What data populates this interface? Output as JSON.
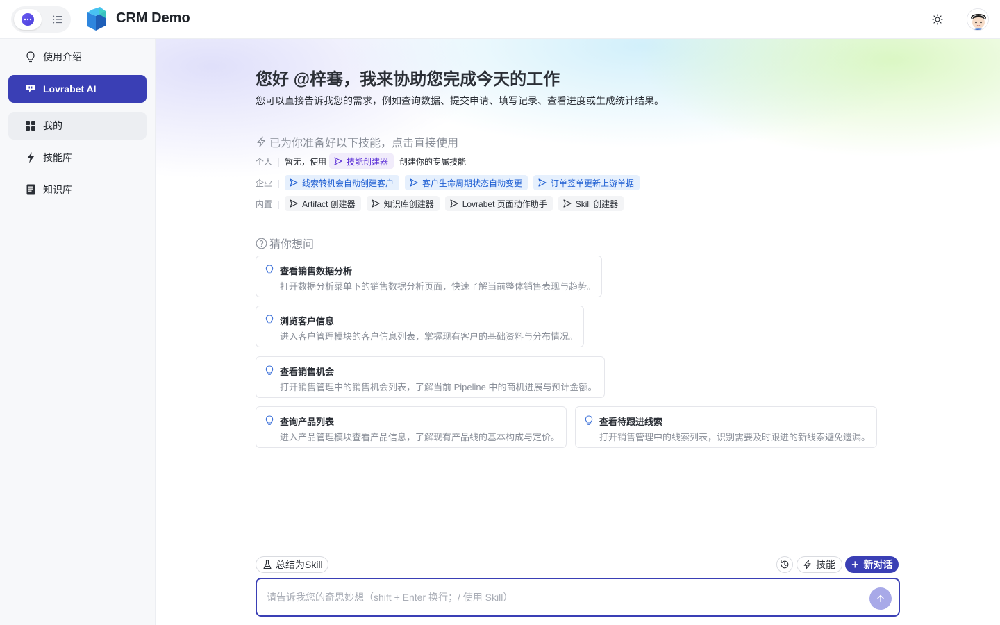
{
  "app": {
    "title": "CRM Demo"
  },
  "sidebar": {
    "items": [
      {
        "label": "使用介绍",
        "icon": "lightbulb-icon"
      },
      {
        "label": "Lovrabet AI",
        "icon": "chat-bubble-icon",
        "active": true
      },
      {
        "label": "我的",
        "icon": "grid-icon"
      },
      {
        "label": "技能库",
        "icon": "lightning-icon"
      },
      {
        "label": "知识库",
        "icon": "book-icon"
      }
    ]
  },
  "main": {
    "greeting": "您好 @梓骞，我来协助您完成今天的工作",
    "subtitle": "您可以直接告诉我您的需求，例如查询数据、提交申请、填写记录、查看进度或生成统计结果。",
    "skills": {
      "heading": "已为你准备好以下技能，点击直接使用",
      "personal": {
        "label": "个人",
        "prefix": "暂无，使用",
        "chip": "技能创建器",
        "suffix": "创建你的专属技能"
      },
      "enterprise": {
        "label": "企业",
        "chips": [
          "线索转机会自动创建客户",
          "客户生命周期状态自动变更",
          "订单签单更新上游单据"
        ]
      },
      "builtin": {
        "label": "内置",
        "chips": [
          "Artifact 创建器",
          "知识库创建器",
          "Lovrabet 页面动作助手",
          "Skill 创建器"
        ]
      }
    },
    "suggestions": {
      "heading": "猜你想问",
      "cards": [
        {
          "title": "查看销售数据分析",
          "desc": "打开数据分析菜单下的销售数据分析页面，快速了解当前整体销售表现与趋势。"
        },
        {
          "title": "浏览客户信息",
          "desc": "进入客户管理模块的客户信息列表，掌握现有客户的基础资料与分布情况。"
        },
        {
          "title": "查看销售机会",
          "desc": "打开销售管理中的销售机会列表，了解当前 Pipeline 中的商机进展与预计金额。"
        },
        {
          "title": "查询产品列表",
          "desc": "进入产品管理模块查看产品信息，了解现有产品线的基本构成与定价。"
        },
        {
          "title": "查看待跟进线索",
          "desc": "打开销售管理中的线索列表，识别需要及时跟进的新线索避免遗漏。"
        }
      ]
    }
  },
  "composer": {
    "summarize_label": "总结为Skill",
    "skills_label": "技能",
    "new_chat_label": "新对话",
    "placeholder": "请告诉我您的奇思妙想（shift + Enter 换行；/ 使用 Skill）"
  },
  "colors": {
    "accent": "#3a3fb5",
    "chip_blue": "#1f5fd3",
    "chip_purple": "#5b2fd6"
  }
}
